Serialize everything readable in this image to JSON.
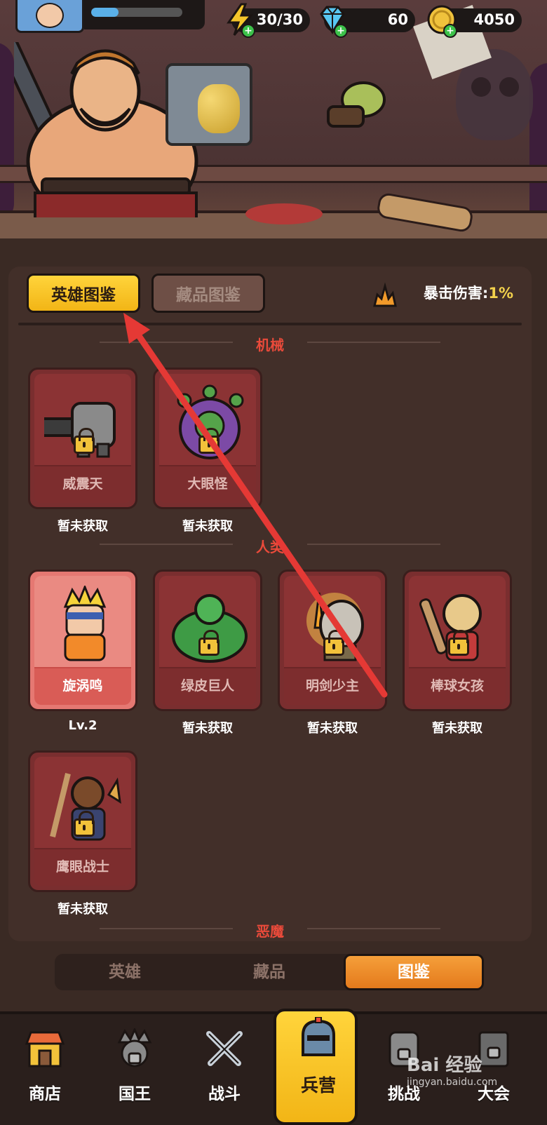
{
  "resources": {
    "energy": "30/30",
    "gems": "60",
    "gold": "4050"
  },
  "xp_fraction": 0.3,
  "tabs": {
    "heroes": "英雄图鉴",
    "collectibles": "藏品图鉴"
  },
  "crit": {
    "label": "暴击伤害:",
    "value": "1%"
  },
  "sections": [
    {
      "title": "机械",
      "cards": [
        {
          "name": "威震天",
          "status": "暂未获取"
        },
        {
          "name": "大眼怪",
          "status": "暂未获取"
        }
      ]
    },
    {
      "title": "人类",
      "cards": [
        {
          "name": "旋涡鸣",
          "status": "Lv.2"
        },
        {
          "name": "绿皮巨人",
          "status": "暂未获取"
        },
        {
          "name": "明剑少主",
          "status": "暂未获取"
        },
        {
          "name": "棒球女孩",
          "status": "暂未获取"
        },
        {
          "name": "鹰眼战士",
          "status": "暂未获取"
        }
      ]
    },
    {
      "title": "恶魔",
      "cards": []
    }
  ],
  "subtabs": [
    "英雄",
    "藏品",
    "图鉴"
  ],
  "nav": [
    "商店",
    "国王",
    "战斗",
    "兵营",
    "挑战",
    "大会"
  ],
  "watermark": {
    "brand": "Bai 经验",
    "url": "jingyan.baidu.com"
  },
  "colors": {
    "accent": "#f2b516",
    "section_title": "#e94a3a",
    "arrow": "#e53935"
  }
}
